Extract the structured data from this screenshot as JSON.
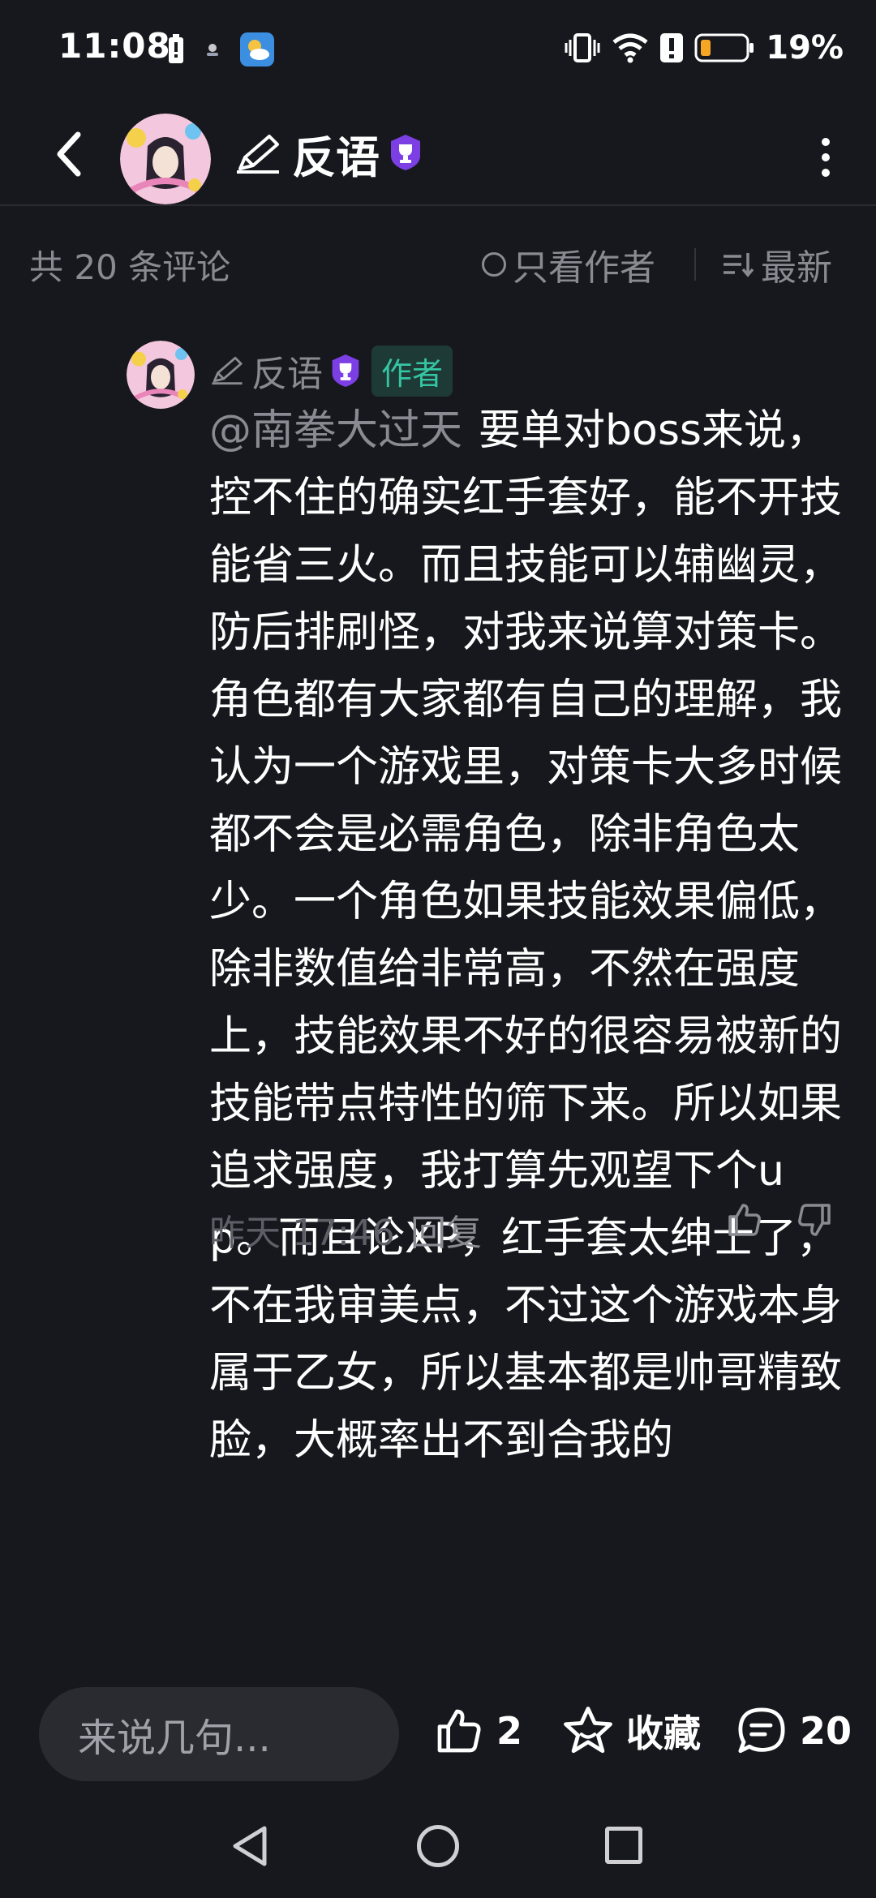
{
  "status_bar": {
    "time": "11:08",
    "battery": "19%",
    "icons": [
      "battery-saver-icon",
      "notification-icon",
      "weather-icon",
      "vibrate-icon",
      "wifi-icon",
      "alert-icon",
      "battery-icon"
    ]
  },
  "header": {
    "title": "反语",
    "icons": [
      "back-icon",
      "avatar",
      "pencil-icon",
      "trophy-badge-icon",
      "more-icon"
    ]
  },
  "filter": {
    "comment_count": "共 20 条评论",
    "only_author": "只看作者",
    "sort": "最新"
  },
  "comment": {
    "author": "反语",
    "author_tag": "作者",
    "mention": "@南拳大过天",
    "text": "要单对boss来说，控不住的确实红手套好，能不开技能省三火。而且技能可以辅幽灵，防后排刷怪，对我来说算对策卡。角色都有大家都有自己的理解，我认为一个游戏里，对策卡大多时候都不会是必需角色，除非角色太少。一个角色如果技能效果偏低，除非数值给非常高，不然在强度上，技能效果不好的很容易被新的技能带点特性的筛下来。所以如果追求强度，我打算先观望下个up。而且论XP，红手套太绅士了，不在我审美点，不过这个游戏本身属于乙女，所以基本都是帅哥精致脸，大概率出不到合我的",
    "time": "昨天 17:46",
    "reply": "回复"
  },
  "action_bar": {
    "input_placeholder": "来说几句...",
    "like_count": "2",
    "favorite_label": "收藏",
    "comment_count": "20"
  },
  "colors": {
    "background": "#17181d",
    "muted_text": "#8a8b92",
    "author_tag_bg": "#1e3a36",
    "author_tag_text": "#35c5a3",
    "badge_purple": "#7b3fe4",
    "input_bg": "#2a2b31"
  }
}
